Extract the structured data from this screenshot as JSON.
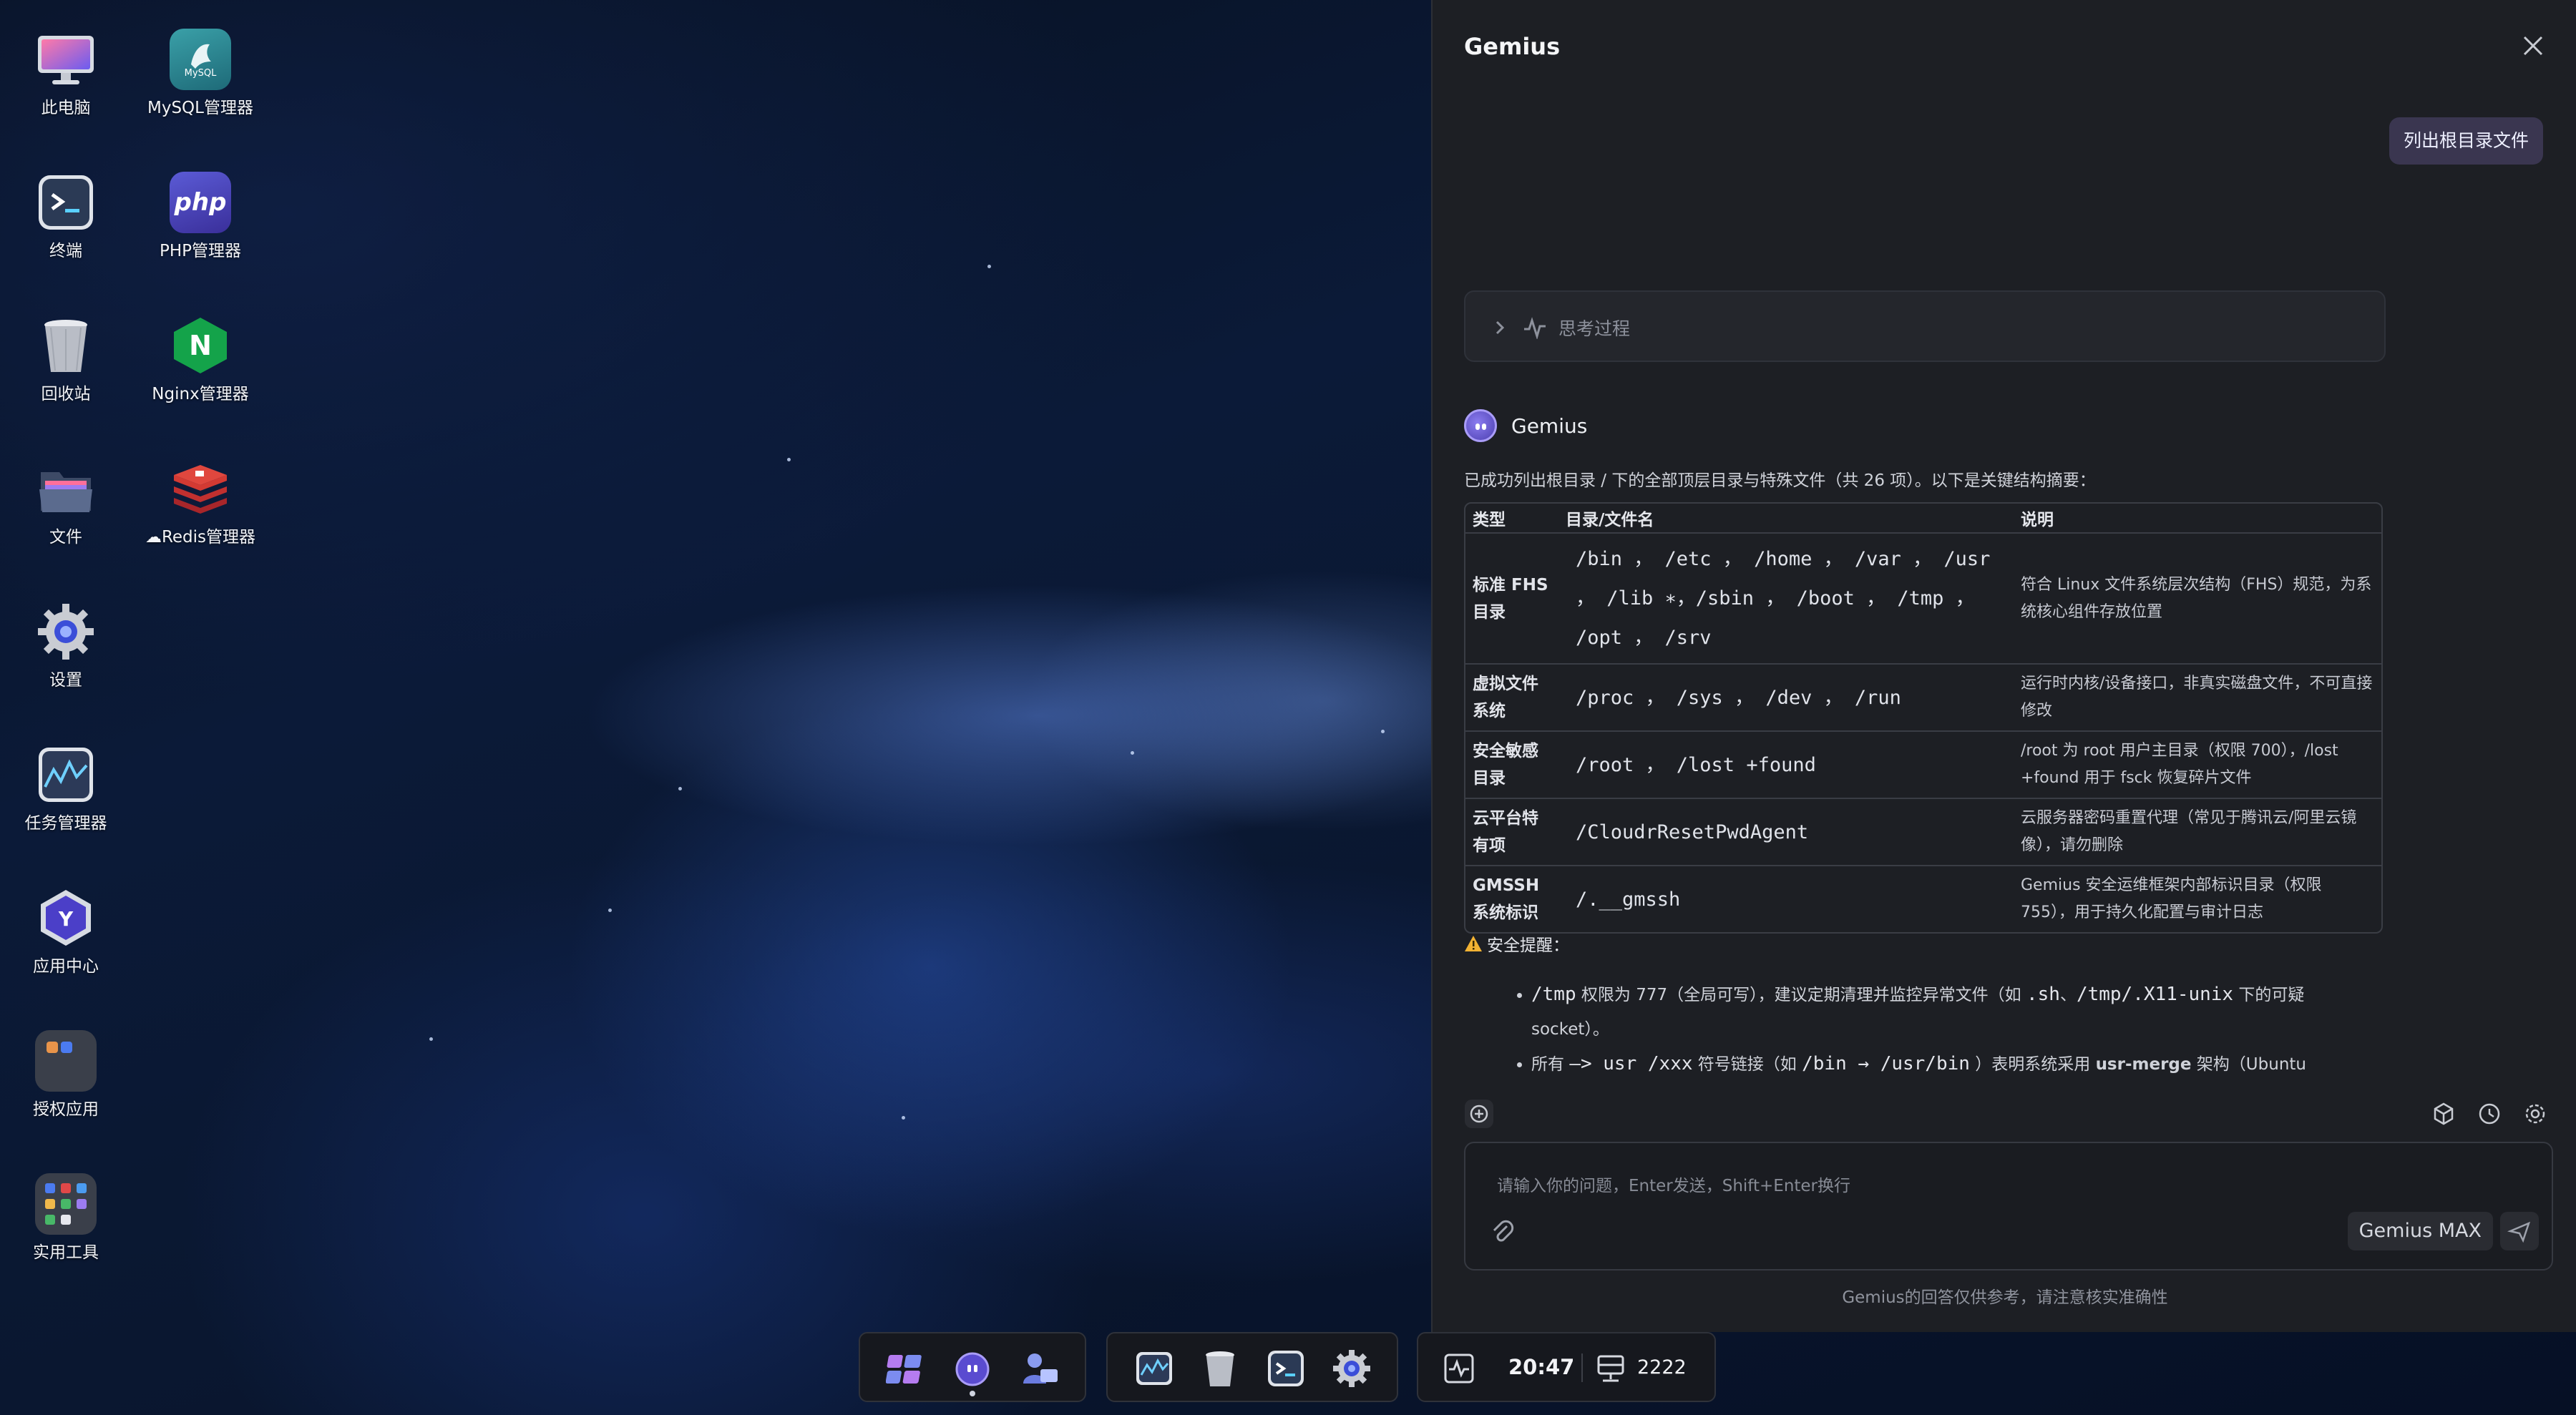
{
  "desktop": {
    "icons": [
      {
        "label": "此电脑",
        "icon": "monitor-icon"
      },
      {
        "label": "MySQL管理器",
        "icon": "mysql-icon"
      },
      {
        "label": "终端",
        "icon": "terminal-icon"
      },
      {
        "label": "PHP管理器",
        "icon": "php-icon"
      },
      {
        "label": "回收站",
        "icon": "trash-icon"
      },
      {
        "label": "Nginx管理器",
        "icon": "nginx-icon"
      },
      {
        "label": "文件",
        "icon": "folder-icon"
      },
      {
        "label": "Redis管理器",
        "icon": "redis-icon"
      },
      {
        "label": "设置",
        "icon": "gear-icon"
      },
      {
        "label": "任务管理器",
        "icon": "task-monitor-icon"
      },
      {
        "label": "应用中心",
        "icon": "app-center-icon"
      },
      {
        "label": "授权应用",
        "icon": "authorized-apps-icon"
      },
      {
        "label": "实用工具",
        "icon": "utilities-icon"
      }
    ]
  },
  "panel": {
    "title": "Gemius",
    "user_message": "列出根目录文件",
    "thinking_label": "思考过程",
    "bot_name": "Gemius",
    "intro": "已成功列出根目录 / 下的全部顶层目录与特殊文件（共 26 项）。以下是关键结构摘要：",
    "table": {
      "headers": [
        "类型",
        "目录/文件名",
        "说明"
      ],
      "rows": [
        {
          "type": "标准 FHS 目录",
          "name": "/bin ， /etc ， /home ， /var ， /usr ， /lib ∗，/sbin ， /boot ， /tmp ， /opt ， /srv",
          "desc": "符合 Linux 文件系统层次结构（FHS）规范，为系统核心组件存放位置"
        },
        {
          "type": "虚拟文件系统",
          "name": "/proc ， /sys ， /dev ， /run",
          "desc": "运行时内核/设备接口，非真实磁盘文件，不可直接修改"
        },
        {
          "type": "安全敏感目录",
          "name": "/root ， /lost +found",
          "desc": "/root  为 root 用户主目录（权限 700），/lost +found 用于 fsck 恢复碎片文件"
        },
        {
          "type": "云平台特有项",
          "name": "/CloudrResetPwdAgent",
          "desc": "云服务器密码重置代理（常见于腾讯云/阿里云镜像），请勿删除"
        },
        {
          "type": "GMSSH 系统标识",
          "name": "/.__gmssh",
          "desc": "Gemius 安全运维框架内部标识目录（权限 755），用于持久化配置与审计日志"
        }
      ]
    },
    "warning_title": "安全提醒：",
    "bullets": [
      {
        "code1": "/tmp",
        "text1": " 权限为 777（全局可写），建议定期清理并监控异常文件（如 ",
        "code2": ".sh",
        "text2": "、",
        "code3": "/tmp/.X11-unix",
        "text3": " 下的可疑 socket）。"
      },
      {
        "text0": "所有 ",
        "code1": "–> usr /xxx",
        "text1": " 符号链接（如 ",
        "code2": "/bin  →  /usr/bin",
        "text2": " ）表明系统采用 ",
        "bold": "usr-merge",
        "text3": " 架构（Ubuntu"
      }
    ],
    "input_placeholder": "请输入你的问题，Enter发送，Shift+Enter换行",
    "model_label": "Gemius MAX",
    "disclaimer": "Gemius的回答仅供参考，请注意核实准确性"
  },
  "taskbar": {
    "clock": "20:47",
    "port": "2222"
  }
}
